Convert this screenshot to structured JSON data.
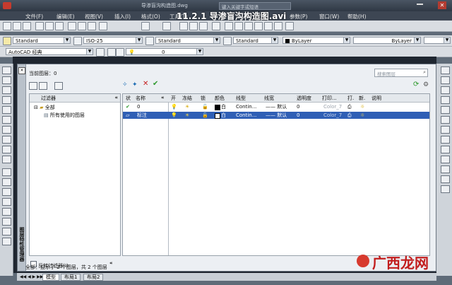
{
  "window": {
    "file_title": "导渗盲沟构造图.dwg",
    "video_title": "11.2.1 导渗盲沟构造图.avi",
    "search_placeholder": "键入关键字或短语"
  },
  "menu": [
    "文件(F)",
    "编辑(E)",
    "视图(V)",
    "插入(I)",
    "格式(O)",
    "工具(T)",
    "参数(P)",
    "窗口(W)",
    "帮助(H)"
  ],
  "toolbars": {
    "text_style": "Standard",
    "dim_style": "ISO-25",
    "table_style": "Standard",
    "multileader_style": "Standard",
    "color": "ByLayer",
    "linetype": "ByLayer",
    "workspace": "AutoCAD 经典",
    "layer_current": "0"
  },
  "dialog": {
    "current_layer_label": "当前图层：0",
    "search_placeholder": "搜索图层",
    "side_title": "图层特性管理器",
    "filter_header": "过滤器",
    "tree": {
      "all": "全部",
      "used": "所有使用的图层"
    },
    "invert_filter_label": "反转过滤器(I)",
    "columns": [
      "状",
      "名称",
      "开",
      "冻结",
      "锁",
      "颜色",
      "线型",
      "线宽",
      "透明度",
      "打印...",
      "打.",
      "新.",
      "说明"
    ],
    "layers": [
      {
        "status": "✔",
        "name": "0",
        "color_name": "白",
        "linetype": "Contin...",
        "lineweight": "—— 默认",
        "transparency": "0",
        "plot_style": "Color_7",
        "selected": false
      },
      {
        "status": "▱",
        "name": "标注",
        "color_name": "白",
        "linetype": "Contin...",
        "lineweight": "—— 默认",
        "transparency": "0",
        "plot_style": "Color_7",
        "selected": true
      }
    ],
    "status_text": "全部：显示了 2 个图层，共 2 个图层"
  },
  "tabs": [
    "模型",
    "布局1",
    "布局2"
  ],
  "watermark": "广西龙网"
}
